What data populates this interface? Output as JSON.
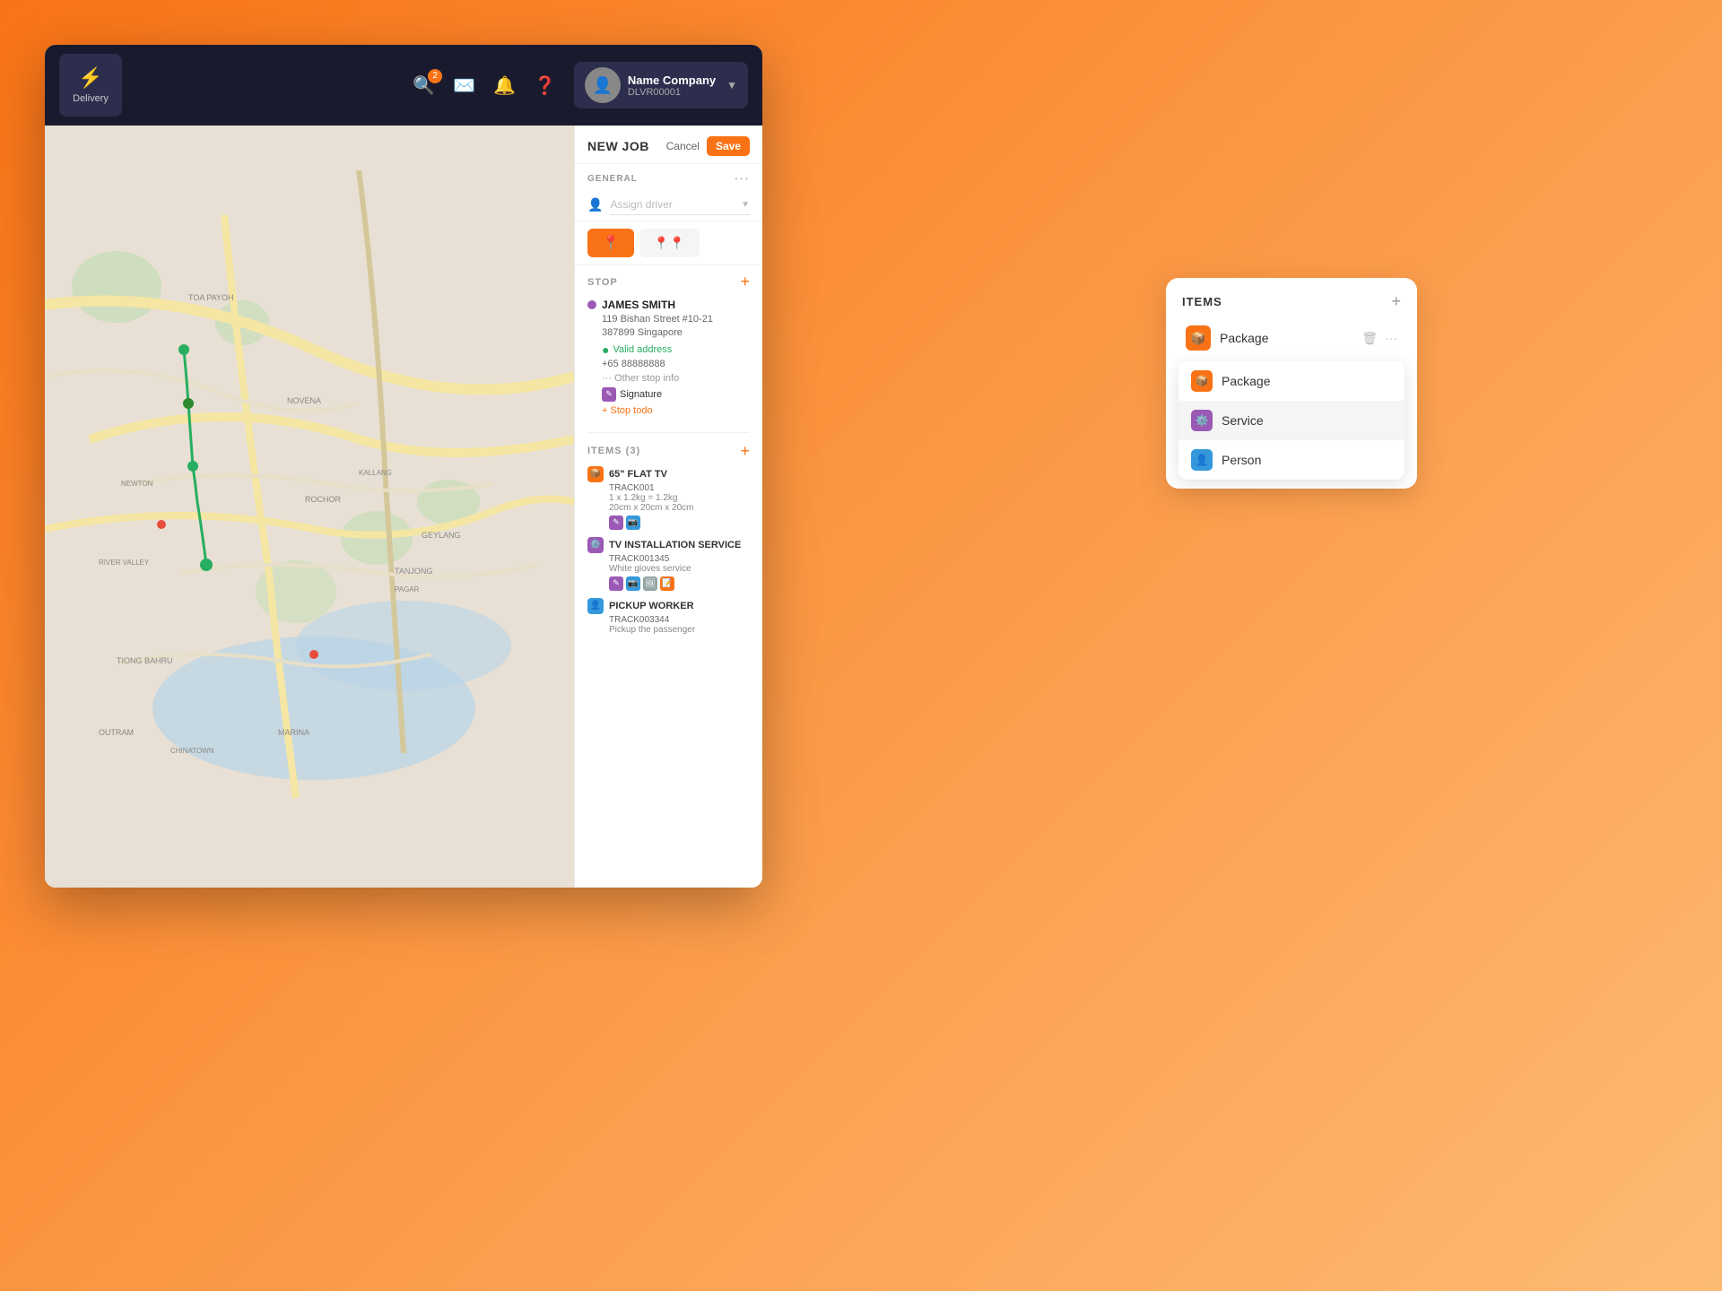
{
  "topbar": {
    "delivery_label": "Delivery",
    "search_badge": "2",
    "user_name": "Name Company",
    "user_id": "DLVR00001"
  },
  "new_job": {
    "title": "NEW JOB",
    "cancel_label": "Cancel",
    "save_label": "Save"
  },
  "general": {
    "section_label": "GENERAL",
    "assign_driver_placeholder": "Assign driver"
  },
  "stop": {
    "section_label": "STOP",
    "customer_name": "JAMES SMITH",
    "address_line1": "119 Bishan Street #10-21",
    "address_line2": "387899 Singapore",
    "valid_address": "Valid address",
    "phone": "+65 88888888",
    "other_info": "··· Other stop info",
    "signature_label": "Signature",
    "stop_todo_label": "+ Stop todo"
  },
  "items": {
    "section_label": "ITEMS (3)",
    "items": [
      {
        "name": "65\" FLAT TV",
        "track": "TRACK001",
        "details": "1 x 1.2kg = 1.2kg",
        "dimensions": "20cm x 20cm x 20cm",
        "icon_type": "orange",
        "tags": [
          "purple",
          "blue"
        ]
      },
      {
        "name": "TV INSTALLATION SERVICE",
        "track": "TRACK001345",
        "details": "White gloves service",
        "icon_type": "purple",
        "tags": [
          "purple",
          "blue",
          "gray",
          "orange"
        ]
      },
      {
        "name": "PICKUP WORKER",
        "track": "TRACK003344",
        "details": "Pickup the passenger",
        "icon_type": "blue",
        "tags": []
      }
    ]
  },
  "popup": {
    "title": "ITEMS",
    "selected_item": {
      "icon_type": "orange",
      "label": "Package"
    },
    "dropdown_options": [
      {
        "label": "Package",
        "icon_type": "orange"
      },
      {
        "label": "Service",
        "icon_type": "purple",
        "hovered": true
      },
      {
        "label": "Person",
        "icon_type": "blue"
      }
    ]
  }
}
